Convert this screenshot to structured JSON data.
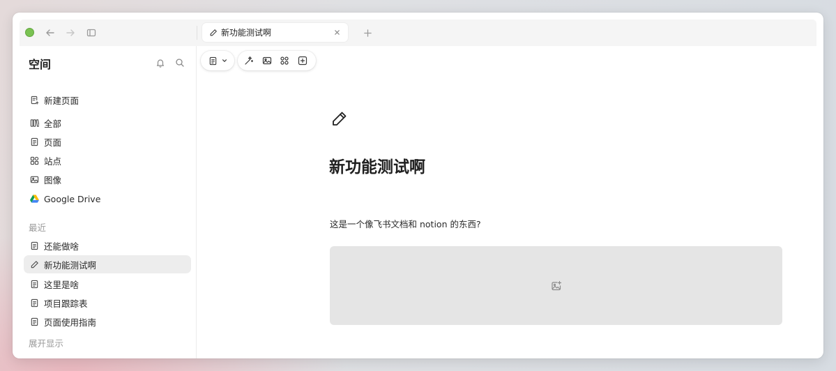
{
  "window": {
    "tab": {
      "title": "新功能测试啊",
      "icon": "pencil-icon"
    }
  },
  "sidebar": {
    "title": "空间",
    "new_page": {
      "label": "新建页面",
      "icon": "new-page-icon"
    },
    "nav": [
      {
        "label": "全部",
        "icon": "library-icon"
      },
      {
        "label": "页面",
        "icon": "document-icon"
      },
      {
        "label": "站点",
        "icon": "grid-icon"
      },
      {
        "label": "图像",
        "icon": "image-icon"
      },
      {
        "label": "Google Drive",
        "icon": "google-drive-icon"
      }
    ],
    "recent_label": "最近",
    "recent": [
      {
        "label": "还能做啥",
        "icon": "document-icon"
      },
      {
        "label": "新功能测试啊",
        "icon": "pencil-icon",
        "active": true
      },
      {
        "label": "这里是啥",
        "icon": "document-icon"
      },
      {
        "label": "项目跟踪表",
        "icon": "document-icon"
      },
      {
        "label": "页面使用指南",
        "icon": "document-icon"
      }
    ],
    "expand_label": "展开显示"
  },
  "page": {
    "icon": "pencil-icon",
    "title": "新功能测试啊",
    "body": "这是一个像飞书文档和 notion 的东西?"
  },
  "colors": {
    "traffic_light": "#7ac252",
    "active_item_bg": "#ededed",
    "image_block_bg": "#e5e5e5"
  }
}
